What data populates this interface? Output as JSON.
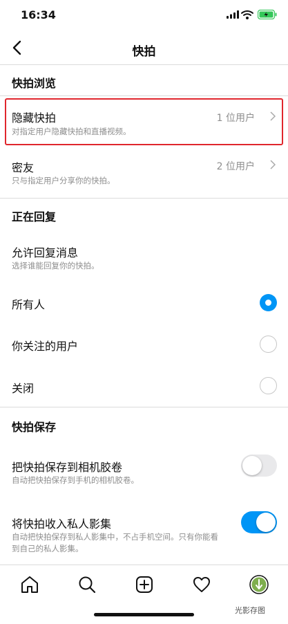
{
  "status": {
    "time": "16:34"
  },
  "header": {
    "title": "快拍"
  },
  "sections": {
    "browse": "快拍浏览",
    "replies": "正在回复",
    "saving": "快拍保存"
  },
  "hide_story": {
    "title": "隐藏快拍",
    "subtitle": "对指定用户隐藏快拍和直播视频。",
    "value": "1 位用户"
  },
  "close_friends": {
    "title": "密友",
    "subtitle": "只与指定用户分享你的快拍。",
    "value": "2 位用户"
  },
  "allow_replies": {
    "title": "允许回复消息",
    "subtitle": "选择谁能回复你的快拍。"
  },
  "reply_options": [
    {
      "label": "所有人",
      "selected": true
    },
    {
      "label": "你关注的用户",
      "selected": false
    },
    {
      "label": "关闭",
      "selected": false
    }
  ],
  "save_camera_roll": {
    "title": "把快拍保存到相机胶卷",
    "subtitle": "自动把快拍保存到手机的相机胶卷。",
    "enabled": false
  },
  "save_archive": {
    "title": "将快拍收入私人影集",
    "subtitle_line1": "自动把快拍保存到私人影集中，不占手机空间。只有你能看",
    "subtitle_line2": "到自己的私人影集。",
    "enabled": true
  },
  "watermark": "光影存图",
  "colors": {
    "accent": "#0095f6",
    "highlight": "#e0262d"
  }
}
